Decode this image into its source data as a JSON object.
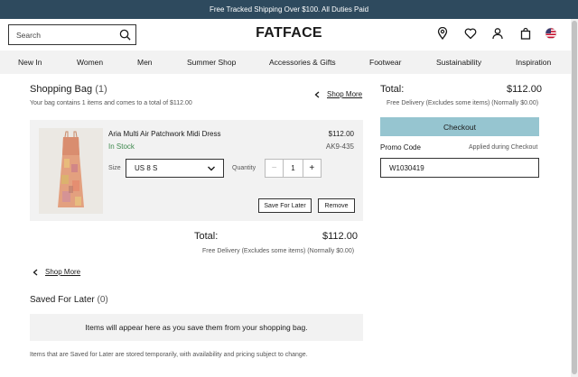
{
  "promo_bar": {
    "text": "Free Tracked Shipping Over $100. All Duties Paid"
  },
  "header": {
    "search_placeholder": "Search",
    "logo": "FATFACE",
    "icons": [
      "map-pin-icon",
      "heart-icon",
      "user-icon",
      "bag-icon",
      "us-flag-icon"
    ]
  },
  "nav": {
    "items": [
      {
        "label": "New In"
      },
      {
        "label": "Women"
      },
      {
        "label": "Men"
      },
      {
        "label": "Summer Shop"
      },
      {
        "label": "Accessories & Gifts"
      },
      {
        "label": "Footwear"
      },
      {
        "label": "Sustainability"
      },
      {
        "label": "Inspiration"
      }
    ]
  },
  "bag": {
    "title": "Shopping Bag",
    "count": "(1)",
    "subtitle": "Your bag contains 1 items and comes to a total of $112.00",
    "shop_more": "Shop More"
  },
  "item": {
    "name": "Aria Multi Air Patchwork Midi Dress",
    "price": "$112.00",
    "stock": "In Stock",
    "sku": "AK9-435",
    "size_label": "Size",
    "size_value": "US 8 S",
    "quantity_label": "Quantity",
    "quantity": "1",
    "save_for_later": "Save For Later",
    "remove": "Remove"
  },
  "totals": {
    "label": "Total:",
    "value": "$112.00",
    "delivery": "Free Delivery (Excludes some items) (Normally $0.00)",
    "shop_more": "Shop More"
  },
  "saved": {
    "title": "Saved For Later",
    "count": "(0)",
    "empty_text": "Items will appear here as you save them from your shopping bag.",
    "note": "Items that are Saved for Later are stored temporarily, with availability and pricing subject to change."
  },
  "summary": {
    "label": "Total:",
    "value": "$112.00",
    "delivery": "Free Delivery (Excludes some items) (Normally $0.00)",
    "checkout": "Checkout",
    "promo_label": "Promo Code",
    "promo_hint": "Applied during Checkout",
    "promo_value": "W1030419"
  },
  "colors": {
    "promo_bar_bg": "#2e4a5e",
    "checkout_bg": "#96c5d0",
    "in_stock": "#3f8a4f"
  }
}
